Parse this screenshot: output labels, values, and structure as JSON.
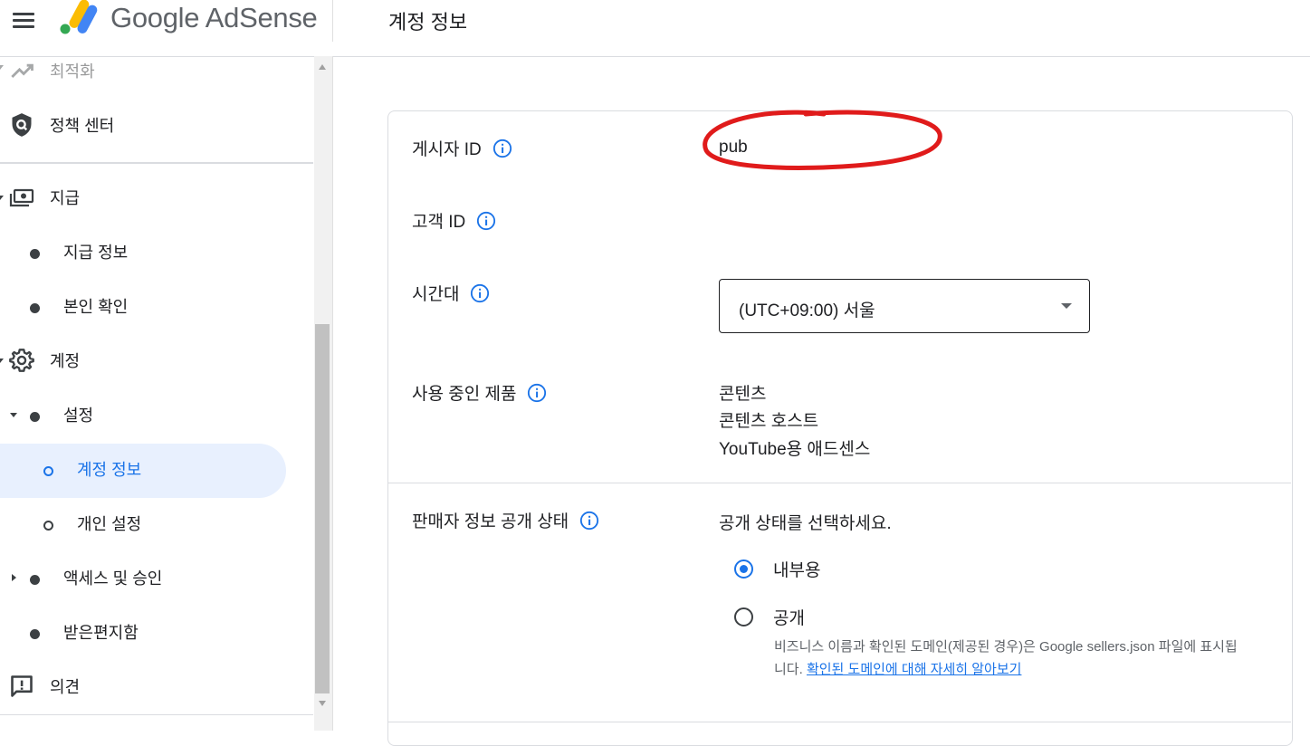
{
  "header": {
    "brand": "Google AdSense",
    "page_title": "계정 정보"
  },
  "sidebar": {
    "items": [
      {
        "label": "최적화",
        "icon": "trending-up-icon"
      },
      {
        "label": "정책 센터",
        "icon": "policy-shield-icon"
      },
      {
        "label": "지급",
        "icon": "payments-icon"
      },
      {
        "label": "지급 정보"
      },
      {
        "label": "본인 확인"
      },
      {
        "label": "계정",
        "icon": "gear-icon"
      },
      {
        "label": "설정"
      },
      {
        "label": "계정 정보",
        "active": true
      },
      {
        "label": "개인 설정"
      },
      {
        "label": "액세스 및 승인"
      },
      {
        "label": "받은편지함"
      },
      {
        "label": "의견",
        "icon": "feedback-icon"
      }
    ]
  },
  "account_info": {
    "publisher_id_label": "게시자 ID",
    "publisher_id_value": "pub",
    "customer_id_label": "고객 ID",
    "timezone_label": "시간대",
    "timezone_value": "(UTC+09:00) 서울",
    "products_label": "사용 중인 제품",
    "products": [
      "콘텐츠",
      "콘텐츠 호스트",
      "YouTube용 애드센스"
    ],
    "seller_label": "판매자 정보 공개 상태",
    "seller_prompt": "공개 상태를 선택하세요.",
    "options": [
      {
        "label": "내부용",
        "selected": true
      },
      {
        "label": "공개",
        "selected": false
      }
    ],
    "help_text": "비즈니스 이름과 확인된 도메인(제공된 경우)은 Google sellers.json 파일에 표시됩니다.",
    "help_link": "확인된 도메인에 대해 자세히 알아보기"
  },
  "colors": {
    "accent": "#1a73e8",
    "active_bg": "#e8f0fe",
    "annotation": "#e01b1b"
  }
}
